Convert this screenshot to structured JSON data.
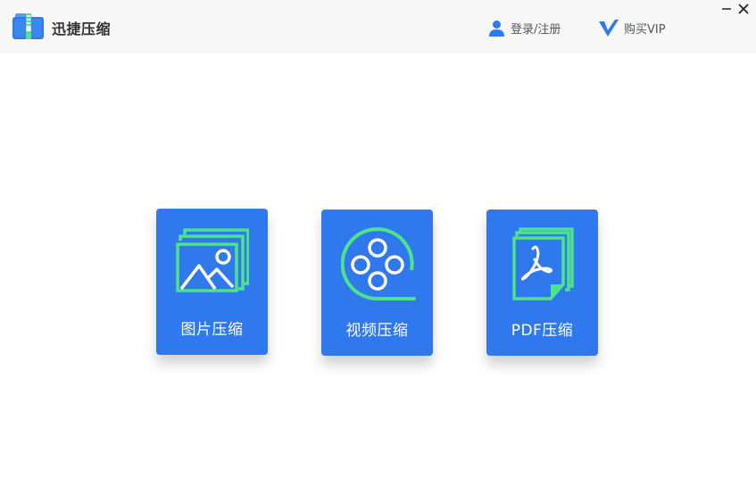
{
  "app": {
    "title": "迅捷压缩",
    "logo_icon": "zip-folder-icon",
    "accent_color": "#2f78ee",
    "icon_stroke_color": "#4de38a"
  },
  "header": {
    "login_label": "登录/注册",
    "login_icon": "user-icon",
    "vip_label": "购买VIP",
    "vip_icon": "vip-v-icon"
  },
  "window_controls": {
    "minimize_icon": "minimize-icon",
    "close_icon": "close-icon"
  },
  "cards": [
    {
      "label": "图片压缩",
      "icon": "image-icon"
    },
    {
      "label": "视频压缩",
      "icon": "film-reel-icon"
    },
    {
      "label": "PDF压缩",
      "icon": "pdf-document-icon"
    }
  ]
}
